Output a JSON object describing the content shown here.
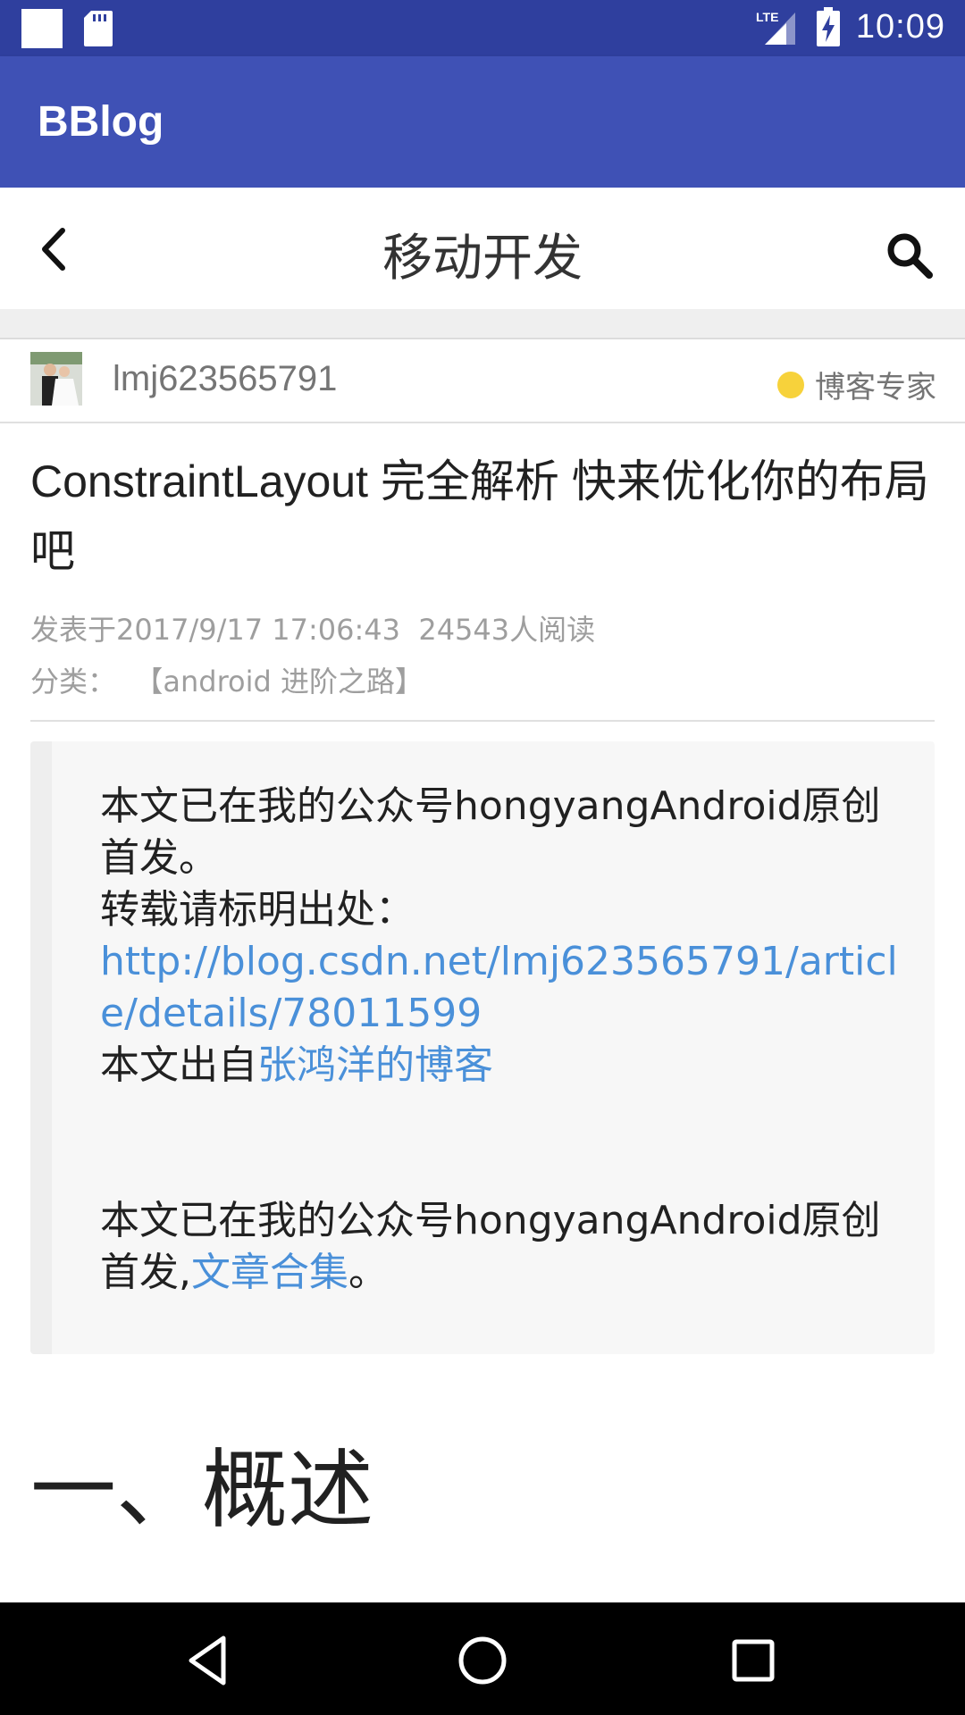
{
  "status_bar": {
    "network": "LTE",
    "time": "10:09"
  },
  "app_bar": {
    "title": "BBlog"
  },
  "nav_bar": {
    "title": "移动开发",
    "back_icon": "chevron-left-icon",
    "search_icon": "search-icon"
  },
  "author": {
    "name": "lmj623565791",
    "badge": "博客专家",
    "badge_color": "#f7d23b"
  },
  "article": {
    "title": "ConstraintLayout 完全解析 快来优化你的布局吧",
    "published": "发表于2017/9/17 17:06:43",
    "reads": "24543人阅读",
    "category_label": "分类：",
    "category_value": "【android 进阶之路】"
  },
  "quote": {
    "line1": "本文已在我的公众号hongyangAndroid原创首发。",
    "line2": "转载请标明出处：",
    "url": "http://blog.csdn.net/lmj623565791/article/details/78011599",
    "from_prefix": "本文出自",
    "from_link": "张鸿洋的博客",
    "line3_prefix": "本文已在我的公众号hongyangAndroid原创首发,",
    "line3_link": "文章合集",
    "line3_suffix": "。"
  },
  "section": {
    "heading": "一、概述"
  },
  "colors": {
    "status_bar": "#2f3f9e",
    "app_bar": "#3f51b5",
    "link": "#4a90d9"
  },
  "system_nav": {
    "back": "back-triangle-icon",
    "home": "home-circle-icon",
    "recents": "recents-square-icon"
  }
}
